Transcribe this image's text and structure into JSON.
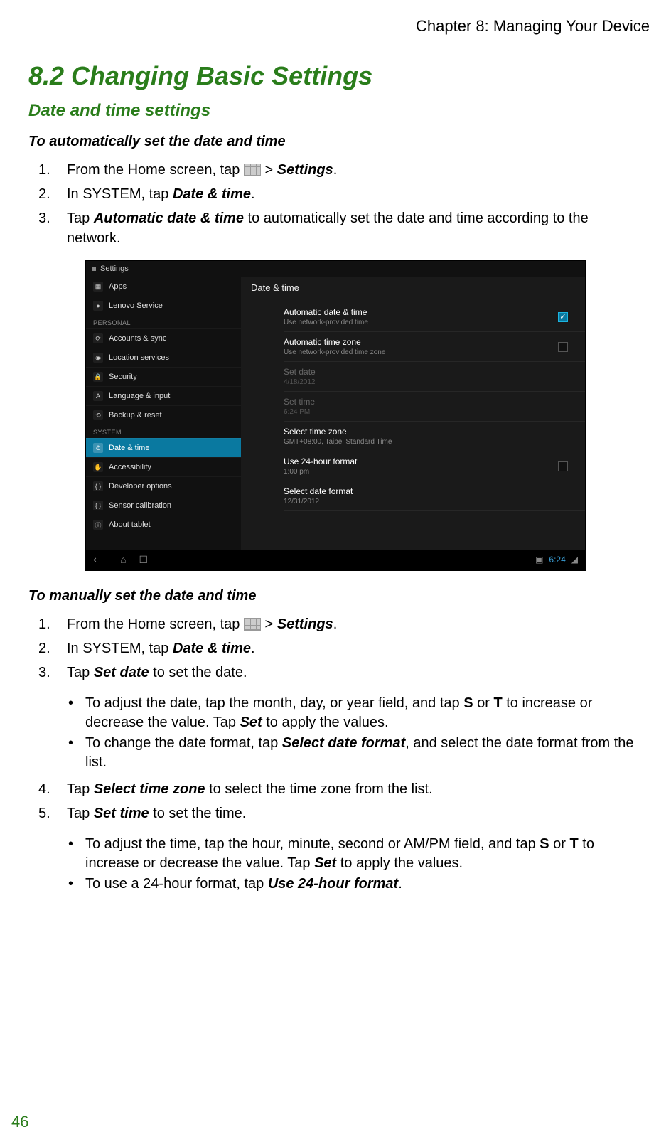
{
  "header": {
    "chapter": "Chapter 8: Managing Your Device"
  },
  "page_number": "46",
  "section": {
    "title": "8.2 Changing Basic Settings",
    "subsection": "Date and time settings",
    "auto_heading": "To automatically set the date and time",
    "auto_steps": {
      "s1_prefix": "From the Home screen, tap   ",
      "s1_sep": "  > ",
      "s1_settings": "Settings",
      "s1_period": ".",
      "s2_prefix": "In SYSTEM, tap ",
      "s2_dt": "Date & time",
      "s2_period": ".",
      "s3_prefix": "Tap ",
      "s3_auto": "Automatic date & time",
      "s3_rest": " to automatically set the date and time according to the network."
    },
    "manual_heading": "To manually set the date and time",
    "manual_steps": {
      "s1_prefix": "From the Home screen, tap   ",
      "s1_sep": "  > ",
      "s1_settings": "Settings",
      "s1_period": ".",
      "s2_prefix": "In SYSTEM, tap ",
      "s2_dt": "Date & time",
      "s2_period": ".",
      "s3_prefix": "Tap ",
      "s3_sd": "Set date",
      "s3_rest": " to set the date.",
      "b1_prefix": "To adjust the date, tap the month, day, or year field, and tap ",
      "b1_s": "S",
      "b1_or": " or ",
      "b1_t": "T",
      "b1_mid": " to increase or decrease the value. Tap ",
      "b1_set": "Set",
      "b1_end": " to apply the values.",
      "b2_prefix": "To change the date format, tap ",
      "b2_sdf": "Select date format",
      "b2_end": ", and select the date format from the list.",
      "s4_prefix": "Tap ",
      "s4_stz": "Select time zone",
      "s4_rest": " to select the time zone from the list.",
      "s5_prefix": "Tap ",
      "s5_st": "Set time",
      "s5_rest": " to set the time.",
      "b3_prefix": "To adjust the time, tap the hour, minute, second or AM/PM field, and tap ",
      "b3_s": "S",
      "b3_or": " or ",
      "b3_t": "T",
      "b3_mid": " to increase or decrease the value. Tap ",
      "b3_set": "Set",
      "b3_end": " to apply the values.",
      "b4_prefix": "To use a 24-hour format, tap ",
      "b4_u24": "Use 24-hour format",
      "b4_end": "."
    },
    "numbers": {
      "n1": "1.",
      "n2": "2.",
      "n3": "3.",
      "n4": "4.",
      "n5": "5."
    }
  },
  "device": {
    "statusbar_title": "Settings",
    "sidebar": {
      "items_top": [
        {
          "icon": "▦",
          "label": "Apps"
        },
        {
          "icon": "●",
          "label": "Lenovo Service"
        }
      ],
      "section_personal": "PERSONAL",
      "items_personal": [
        {
          "icon": "⟳",
          "label": "Accounts & sync"
        },
        {
          "icon": "◉",
          "label": "Location services"
        },
        {
          "icon": "🔒",
          "label": "Security"
        },
        {
          "icon": "A",
          "label": "Language & input"
        },
        {
          "icon": "⟲",
          "label": "Backup & reset"
        }
      ],
      "section_system": "SYSTEM",
      "items_system": [
        {
          "icon": "⏱",
          "label": "Date & time",
          "selected": true
        },
        {
          "icon": "✋",
          "label": "Accessibility"
        },
        {
          "icon": "{ }",
          "label": "Developer options"
        },
        {
          "icon": "{ }",
          "label": "Sensor calibration"
        },
        {
          "icon": "ⓘ",
          "label": "About tablet"
        }
      ]
    },
    "pane": {
      "title": "Date & time",
      "rows": [
        {
          "title": "Automatic date & time",
          "sub": "Use network-provided time",
          "checkbox": true,
          "checked": true
        },
        {
          "title": "Automatic time zone",
          "sub": "Use network-provided time zone",
          "checkbox": true,
          "checked": false
        },
        {
          "title": "Set date",
          "sub": "4/18/2012",
          "disabled": true
        },
        {
          "title": "Set time",
          "sub": "6:24 PM",
          "disabled": true
        },
        {
          "title": "Select time zone",
          "sub": "GMT+08:00, Taipei Standard Time"
        },
        {
          "title": "Use 24-hour format",
          "sub": "1:00 pm",
          "checkbox": true,
          "checked": false
        },
        {
          "title": "Select date format",
          "sub": "12/31/2012"
        }
      ]
    },
    "navbar": {
      "clock": "6:24"
    }
  }
}
